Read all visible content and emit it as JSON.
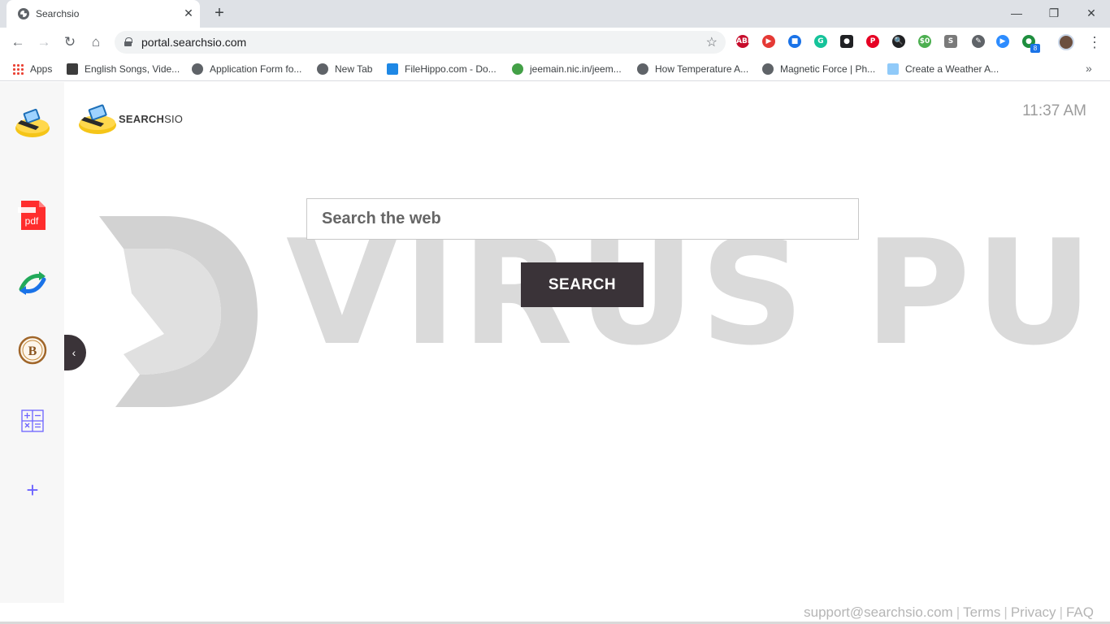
{
  "browser": {
    "tab_title": "Searchsio",
    "url": "portal.searchsio.com",
    "tab_close_glyph": "✕",
    "new_tab_glyph": "+",
    "window_controls": {
      "minimize": "—",
      "restore": "❐",
      "close": "✕"
    },
    "extensions": [
      {
        "name": "adblock-plus-icon",
        "label": "ABP",
        "color": "#c70d2c"
      },
      {
        "name": "video-speed-icon",
        "label": "▶",
        "color": "#e53935"
      },
      {
        "name": "bookmark-ext-icon",
        "label": "■",
        "color": "#1a73e8"
      },
      {
        "name": "grammarly-icon",
        "label": "G",
        "color": "#15c39a"
      },
      {
        "name": "media-ext-icon",
        "label": "●",
        "color": "#202124"
      },
      {
        "name": "pinterest-icon",
        "label": "P",
        "color": "#e60023"
      },
      {
        "name": "search-zoom-icon",
        "label": "🔍",
        "color": "#202124"
      },
      {
        "name": "price-tag-icon",
        "label": "$0",
        "color": "#4caf50"
      },
      {
        "name": "s-ext-icon",
        "label": "S",
        "color": "#7a7a7a"
      },
      {
        "name": "eyedropper-icon",
        "label": "✎",
        "color": "#5f6368"
      },
      {
        "name": "zoom-icon",
        "label": "▶",
        "color": "#2d8cff"
      },
      {
        "name": "chat-ext-icon",
        "label": "●",
        "color": "#1e8e3e"
      }
    ],
    "extension_badge": "8",
    "bookmarks": [
      {
        "label": "Apps"
      },
      {
        "label": "English Songs, Vide..."
      },
      {
        "label": "Application Form fo..."
      },
      {
        "label": "New Tab"
      },
      {
        "label": "FileHippo.com - Do..."
      },
      {
        "label": "jeemain.nic.in/jeem..."
      },
      {
        "label": "How Temperature A..."
      },
      {
        "label": "Magnetic Force | Ph..."
      },
      {
        "label": "Create a Weather A..."
      }
    ],
    "bookmarks_more": "»"
  },
  "page": {
    "brand_bold": "SEARCH",
    "brand_light": "SIO",
    "clock": "11:37 AM",
    "search_placeholder": "Search the web",
    "search_button": "SEARCH",
    "collapse_glyph": "‹",
    "watermark_text": "VIRUS PUP",
    "sidebar_items": [
      {
        "name": "searchsio-logo-icon"
      },
      {
        "name": "pdf-icon",
        "label": "pdf"
      },
      {
        "name": "converter-icon"
      },
      {
        "name": "bitcoin-icon",
        "label": "B"
      },
      {
        "name": "calculator-icon"
      },
      {
        "name": "add-icon",
        "label": "+"
      }
    ],
    "footer": {
      "support": "support@searchsio.com",
      "terms": "Terms",
      "privacy": "Privacy",
      "faq": "FAQ",
      "separator": "|"
    }
  },
  "colors": {
    "button_dark": "#3a3338",
    "sidebar_bg": "#f7f7f7",
    "footer_text": "#b5b5b5",
    "accent_purple": "#6c63ff"
  }
}
